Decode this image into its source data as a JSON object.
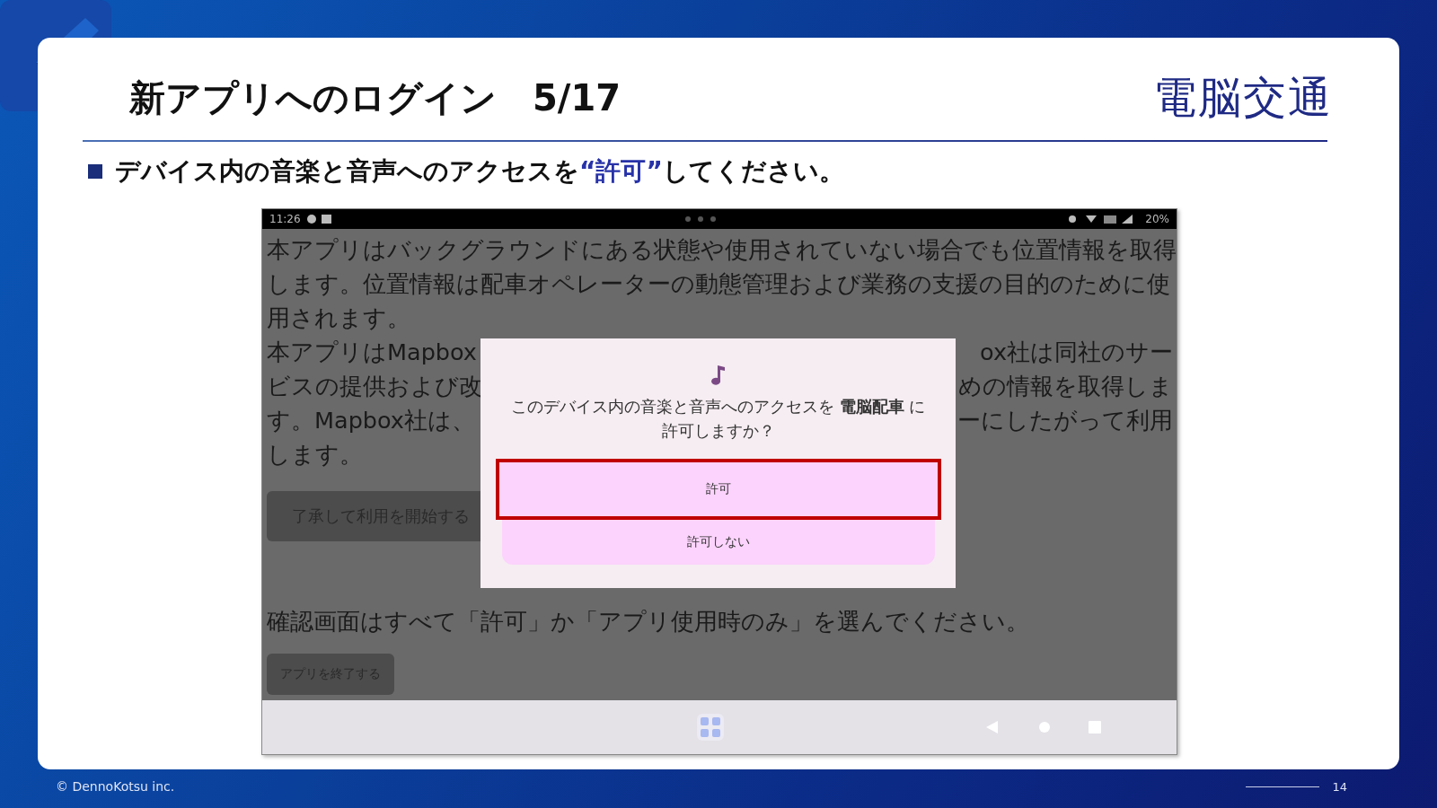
{
  "slide": {
    "title": "新アプリへのログイン　5/17",
    "logo": "電脳交通",
    "instruction": [
      {
        "text": "デバイス内の音楽と音声へのアクセスを",
        "highlight": false
      },
      {
        "text": "“許可”",
        "highlight": true
      },
      {
        "text": "してください。",
        "highlight": false
      }
    ]
  },
  "phone": {
    "status_bar": {
      "time": "11:26",
      "battery": "20%"
    },
    "app_lines": [
      {
        "left": "本アプリはバックグラウンドにある状態や使用されていない場合でも位置情報を取得"
      },
      {
        "left": "します。位置情報は配車オペレーターの動態管理および業務の支援の目的のために使"
      },
      {
        "left": "用されます。"
      },
      {
        "left": "本アプリはMapbox",
        "right": "ox社は同社のサー"
      },
      {
        "left": "ビスの提供および改",
        "right": "めの情報を取得しま"
      },
      {
        "left": "す。Mapbox社は、",
        "right": "ーにしたがって利用"
      },
      {
        "left": "します。"
      }
    ],
    "start_button": "了承して利用を開始する",
    "note": "確認画面はすべて「許可」か「アプリ使用時のみ」を選んでください。",
    "exit_button": "アプリを終了する",
    "dialog": {
      "message": "このデバイス内の音楽と音声へのアクセスを **電脳配車** に許可しますか？",
      "buttons": [
        {
          "label": "許可",
          "highlighted": true
        },
        {
          "label": "許可しない",
          "highlighted": false
        }
      ]
    }
  },
  "footer": {
    "copyright": "© DennoKotsu inc.",
    "page": "14"
  }
}
